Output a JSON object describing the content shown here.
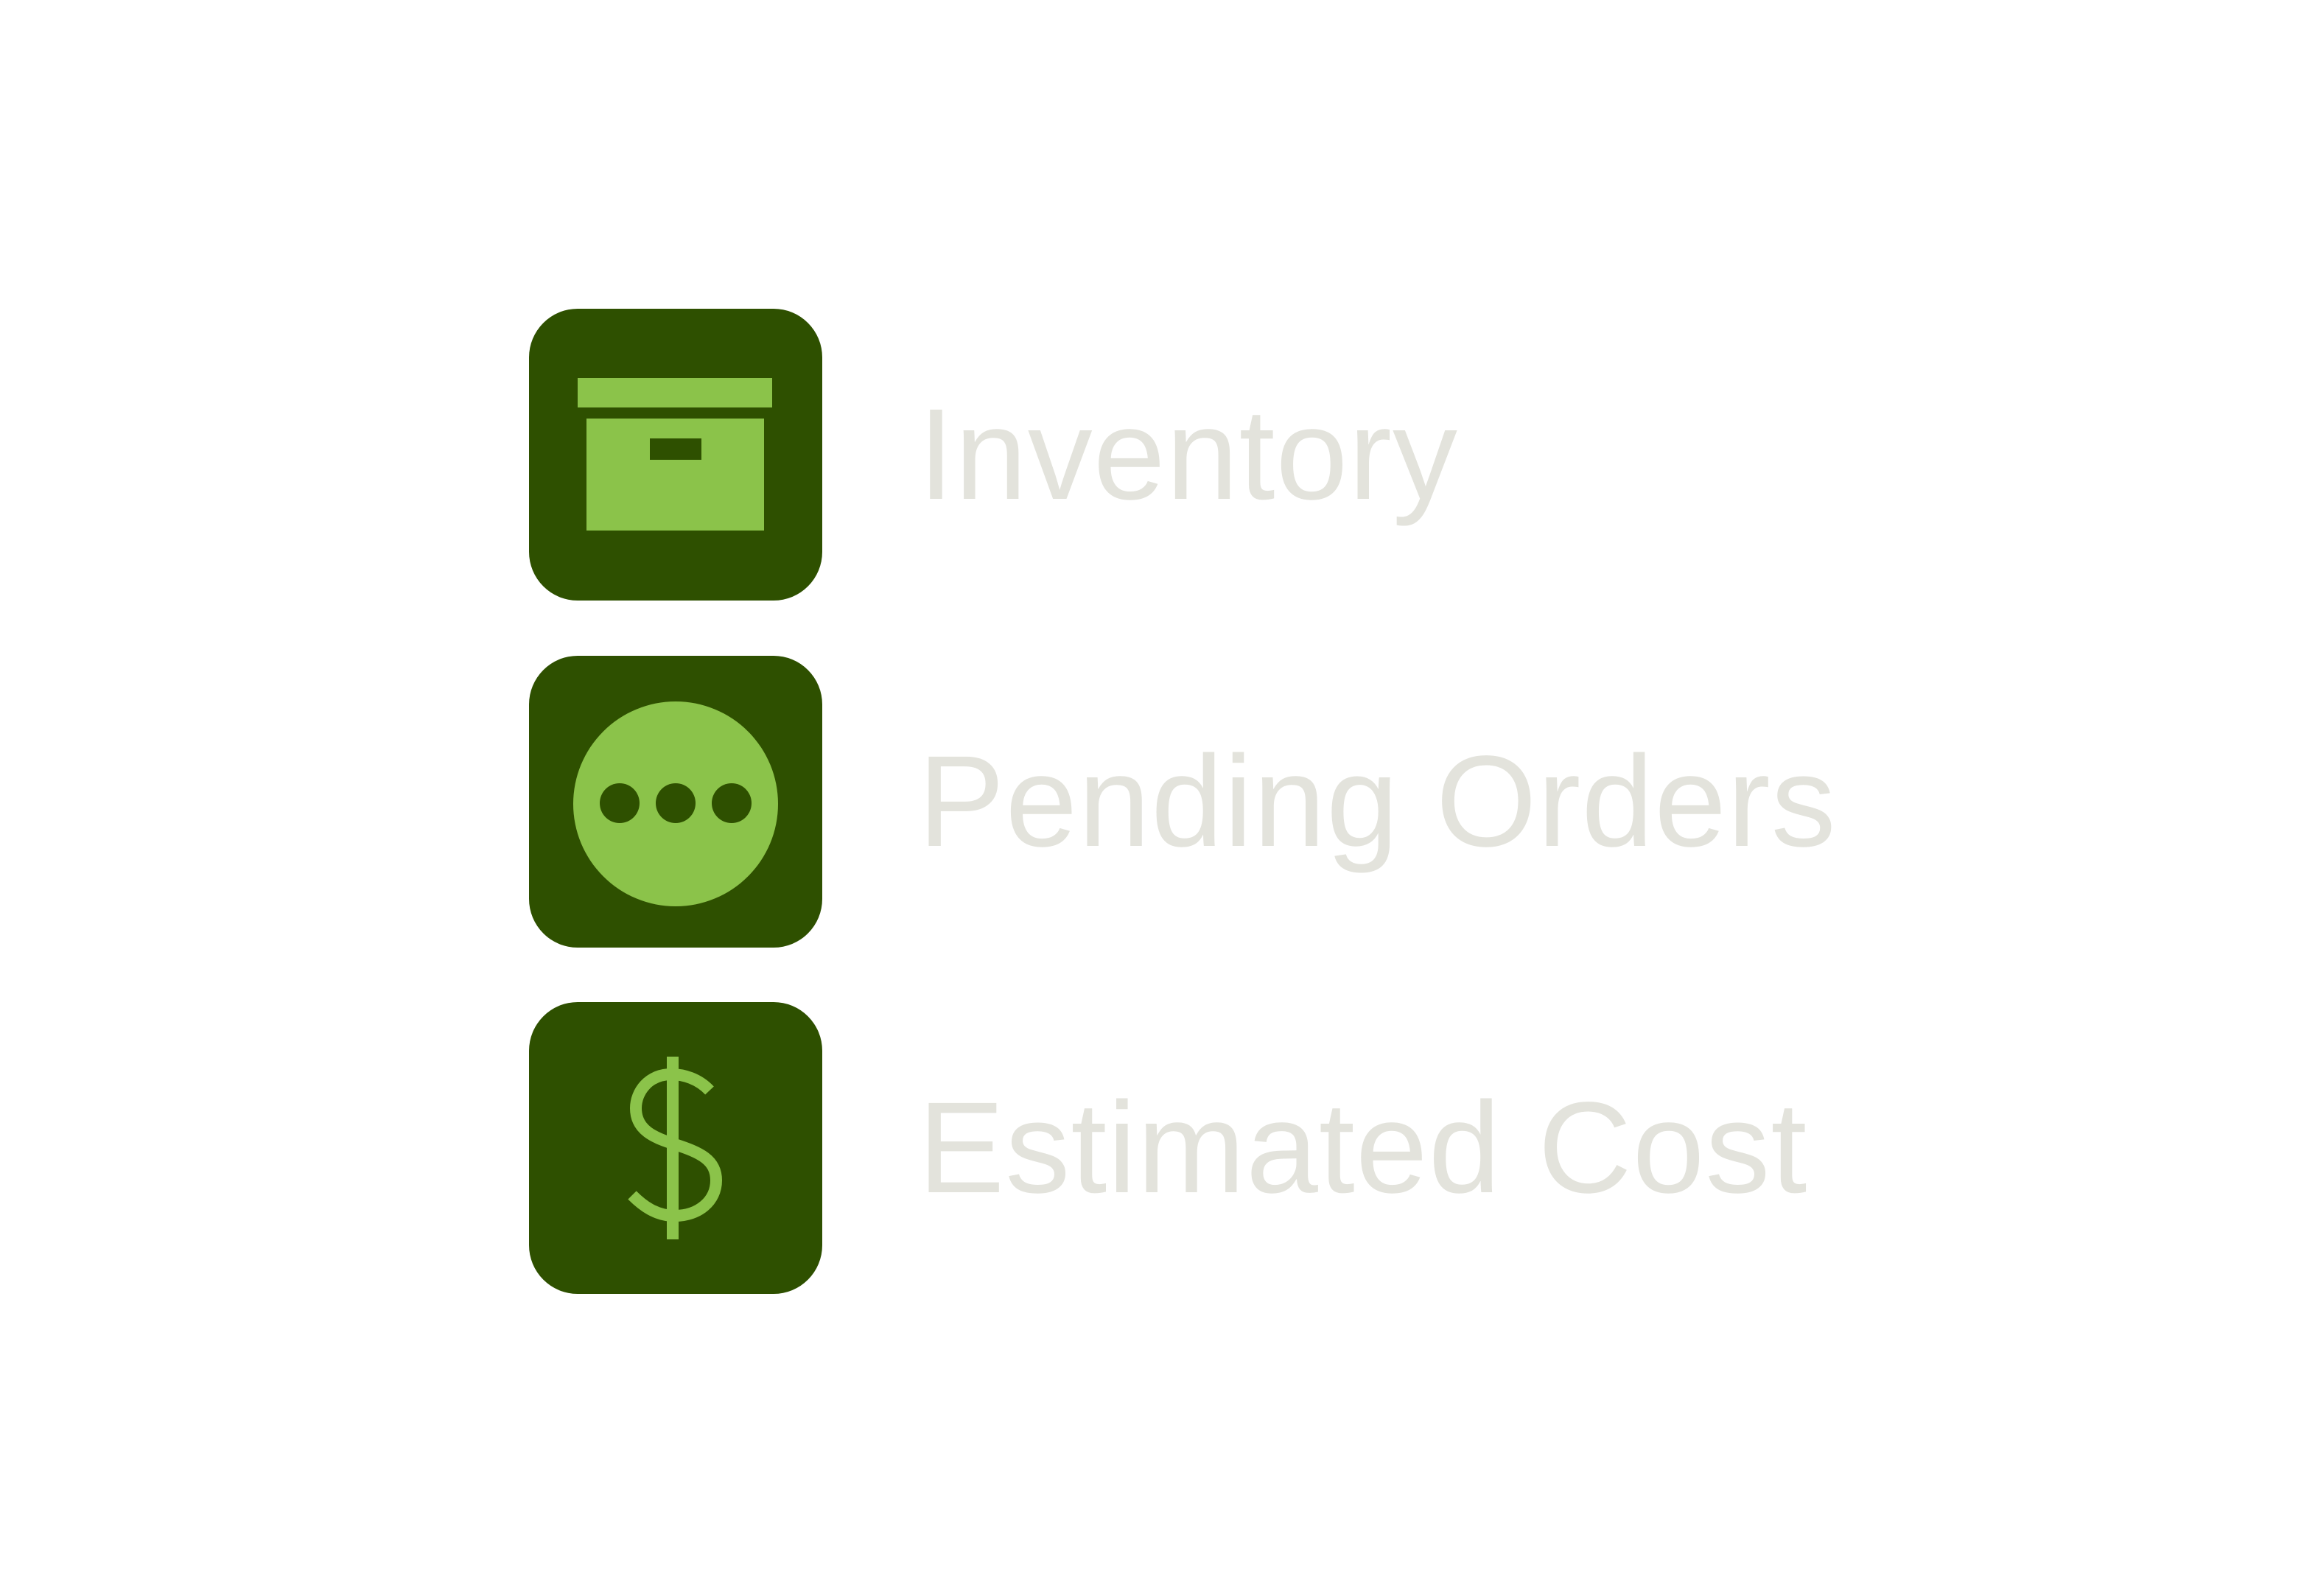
{
  "colors": {
    "tile_background": "#2e5000",
    "icon_accent": "#8bc34a",
    "label_text": "#e3e3dc",
    "page_background": "#ffffff"
  },
  "items": [
    {
      "icon": "archive-box-icon",
      "label": "Inventory"
    },
    {
      "icon": "more-horizontal-circle-icon",
      "label": "Pending Orders"
    },
    {
      "icon": "dollar-sign-icon",
      "label": "Estimated Cost"
    }
  ]
}
